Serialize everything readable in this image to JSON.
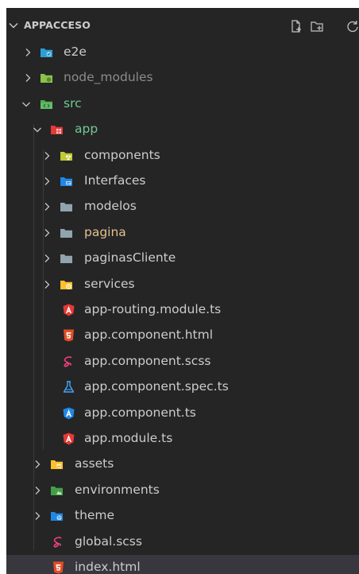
{
  "explorer": {
    "project_title": "APPACCESO"
  },
  "tree": {
    "e2e": "e2e",
    "node_modules": "node_modules",
    "src": "src",
    "app": "app",
    "components": "components",
    "interfaces": "Interfaces",
    "modelos": "modelos",
    "pagina": "pagina",
    "paginas_cliente": "paginasCliente",
    "services": "services",
    "app_routing": "app-routing.module.ts",
    "app_html": "app.component.html",
    "app_scss": "app.component.scss",
    "app_spec": "app.component.spec.ts",
    "app_ts": "app.component.ts",
    "app_module": "app.module.ts",
    "assets": "assets",
    "environments": "environments",
    "theme": "theme",
    "global_scss": "global.scss",
    "index_html": "index.html"
  },
  "colors": {
    "background": "#252526",
    "text": "#cccccc",
    "git_untracked": "#73c991",
    "git_modified": "#e2c08d",
    "git_error": "#f48771",
    "selection": "#37373d"
  },
  "icons": {
    "header": [
      "new-file-icon",
      "new-folder-icon",
      "refresh-icon"
    ],
    "files": [
      "angular-icon",
      "html5-icon",
      "sass-icon",
      "test-flask-icon"
    ],
    "folders": [
      "e2e-folder-icon",
      "node-folder-icon",
      "src-folder-icon",
      "app-folder-icon",
      "components-folder-icon",
      "interfaces-folder-icon",
      "folder-icon",
      "services-folder-icon",
      "assets-folder-icon",
      "environments-folder-icon",
      "theme-folder-icon"
    ]
  }
}
